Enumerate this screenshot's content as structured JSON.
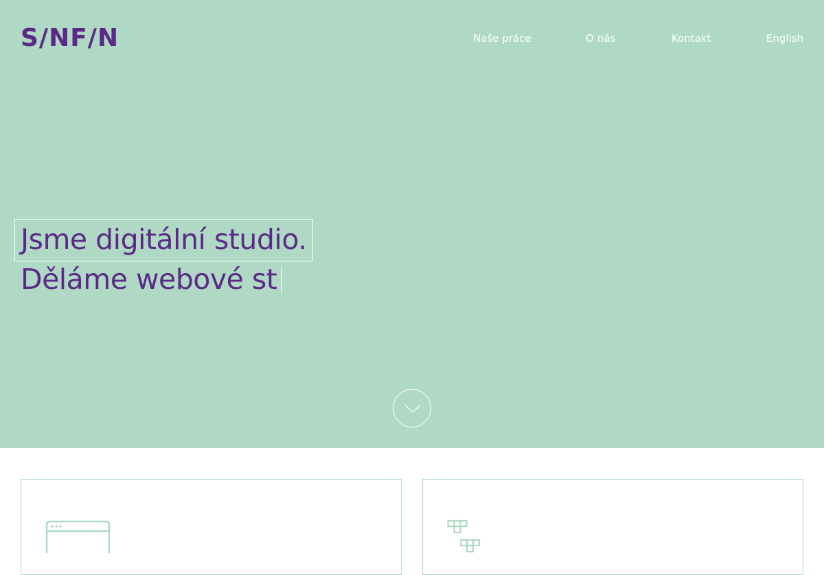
{
  "header": {
    "logo": "S/NF/N",
    "nav": [
      {
        "label": "Naše práce"
      },
      {
        "label": "O nás"
      },
      {
        "label": "Kontakt"
      },
      {
        "label": "English"
      }
    ]
  },
  "hero": {
    "line1": "Jsme digitální studio.",
    "line2": "Děláme webové st"
  },
  "icons": {
    "scroll": "chevron-down-icon",
    "card1": "browser-window-icon",
    "card2": "sitemap-blocks-icon"
  },
  "colors": {
    "hero_background": "#afd8c5",
    "brand_purple": "#5c2a86",
    "outline": "#ffffff",
    "card_border": "#afd8c5"
  }
}
